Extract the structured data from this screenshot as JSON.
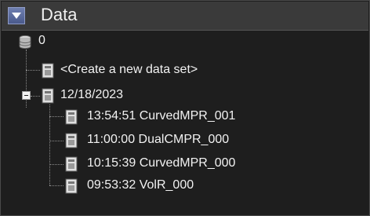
{
  "panel": {
    "title": "Data",
    "collapse_icon": "chevron-down-icon"
  },
  "tree": {
    "root": {
      "label": "0",
      "icon": "database-icon"
    },
    "create_new": {
      "label": "<Create a new data set>",
      "icon": "document-icon"
    },
    "date_group": {
      "label": "12/18/2023",
      "icon": "document-icon",
      "expanded": true,
      "children": [
        {
          "label": "13:54:51 CurvedMPR_001",
          "icon": "document-icon"
        },
        {
          "label": "11:00:00 DualCMPR_000",
          "icon": "document-icon"
        },
        {
          "label": "10:15:39 CurvedMPR_000",
          "icon": "document-icon"
        },
        {
          "label": "09:53:32 VolR_000",
          "icon": "document-icon"
        }
      ]
    }
  },
  "colors": {
    "background": "#1e1e1e",
    "header": "#3a3a3a",
    "text": "#f2f2f2"
  }
}
